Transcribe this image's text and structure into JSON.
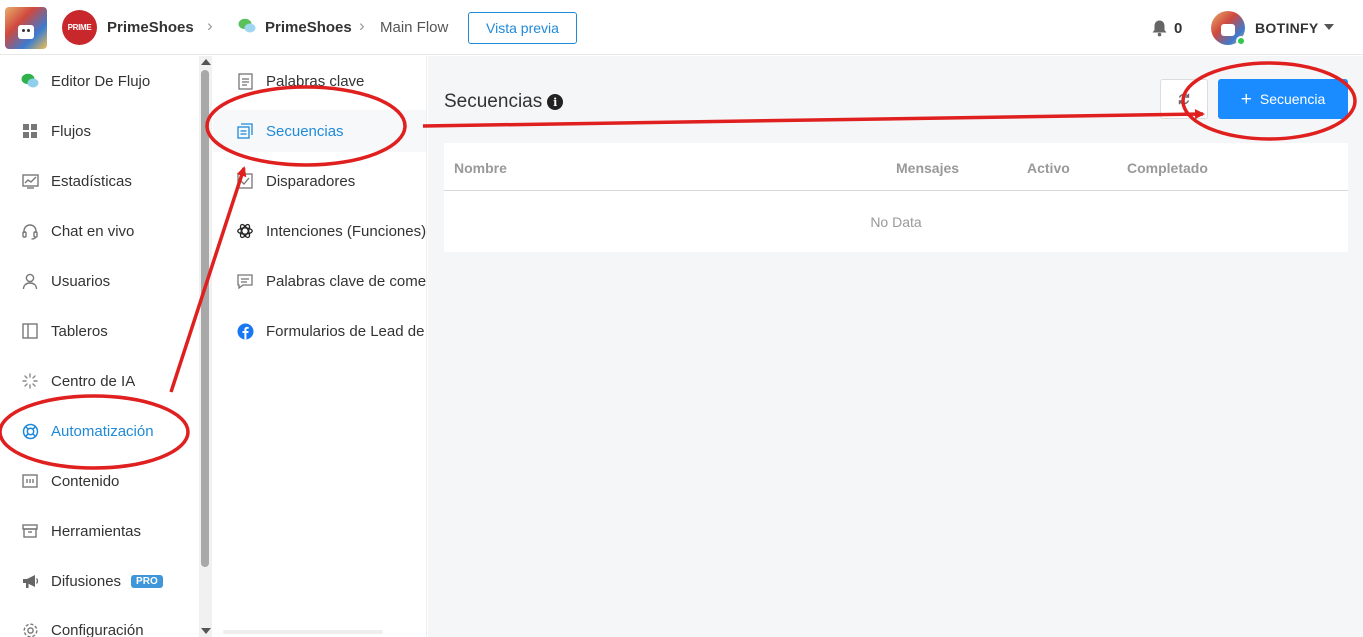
{
  "header": {
    "brand_badge": "PRIME",
    "brand_name": "PrimeShoes",
    "bot_name": "PrimeShoes",
    "flow_name": "Main Flow",
    "preview_label": "Vista previa",
    "notification_count": "0",
    "user_name": "BOTINFY"
  },
  "sidebar": {
    "items": [
      {
        "label": "Editor De Flujo",
        "icon": "chat-bubbles-icon"
      },
      {
        "label": "Flujos",
        "icon": "grid-icon"
      },
      {
        "label": "Estadísticas",
        "icon": "chart-icon"
      },
      {
        "label": "Chat en vivo",
        "icon": "headset-icon"
      },
      {
        "label": "Usuarios",
        "icon": "user-icon"
      },
      {
        "label": "Tableros",
        "icon": "board-icon"
      },
      {
        "label": "Centro de IA",
        "icon": "sparkle-icon"
      },
      {
        "label": "Automatización",
        "icon": "lifebuoy-icon"
      },
      {
        "label": "Contenido",
        "icon": "content-icon"
      },
      {
        "label": "Herramientas",
        "icon": "archive-icon"
      },
      {
        "label": "Difusiones",
        "icon": "megaphone-icon",
        "badge": "PRO"
      },
      {
        "label": "Configuración",
        "icon": "gear-icon"
      }
    ]
  },
  "submenu": {
    "items": [
      {
        "label": "Palabras clave",
        "icon": "document-icon"
      },
      {
        "label": "Secuencias",
        "icon": "sequence-icon"
      },
      {
        "label": "Disparadores",
        "icon": "trigger-icon"
      },
      {
        "label": "Intenciones (Funciones)",
        "icon": "openai-icon"
      },
      {
        "label": "Palabras clave de comen",
        "icon": "comment-icon"
      },
      {
        "label": "Formularios de Lead de F",
        "icon": "facebook-icon"
      }
    ]
  },
  "main": {
    "title": "Secuencias",
    "add_button_label": "Secuencia",
    "table": {
      "columns": [
        "Nombre",
        "Mensajes",
        "Activo",
        "Completado"
      ],
      "empty_text": "No Data"
    }
  },
  "colors": {
    "accent": "#1f8ad8",
    "primary_button": "#1a8cff",
    "annotation": "#e01f1f"
  }
}
